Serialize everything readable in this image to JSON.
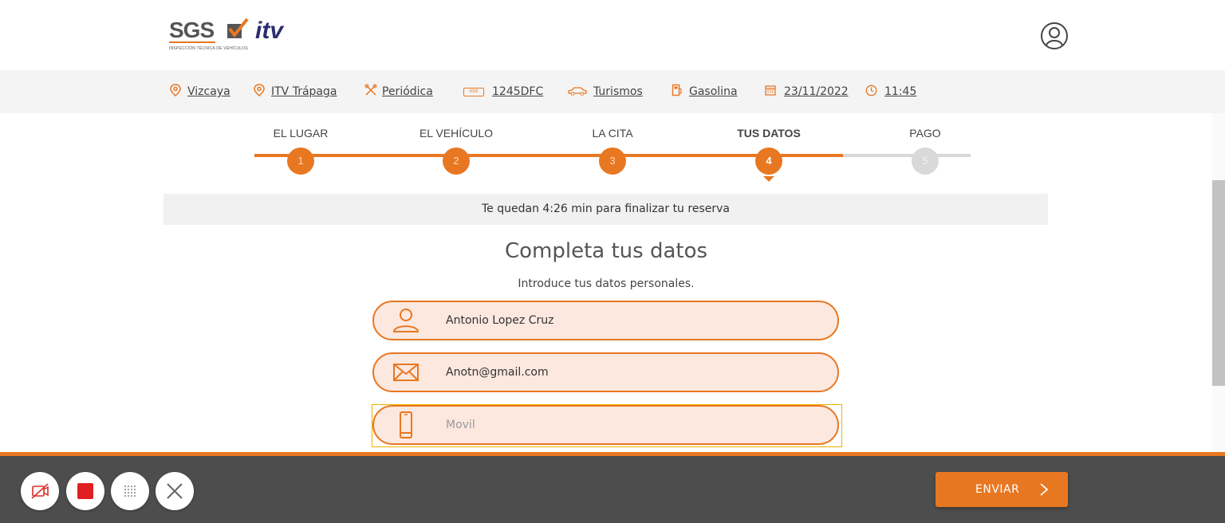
{
  "brand": {
    "logo_text": "SGS",
    "logo_brand": "itv",
    "logo_tagline": "INSPECCIÓN TÉCNICA DE VEHÍCULOS",
    "accent": "#e87722",
    "navy": "#2b2d6e"
  },
  "summary": {
    "province": "Vizcaya",
    "station": "ITV Trápaga",
    "inspection_type": "Periódica",
    "plate": "1245DFC",
    "vehicle_type": "Turismos",
    "fuel": "Gasolina",
    "date": "23/11/2022",
    "time": "11:45"
  },
  "steps": [
    {
      "label": "EL LUGAR",
      "number": "1",
      "state": "done"
    },
    {
      "label": "EL VEHÍCULO",
      "number": "2",
      "state": "done"
    },
    {
      "label": "LA CITA",
      "number": "3",
      "state": "done"
    },
    {
      "label": "TUS DATOS",
      "number": "4",
      "state": "current"
    },
    {
      "label": "PAGO",
      "number": "5",
      "state": "todo"
    }
  ],
  "timer_text": "Te quedan 4:26 min para finalizar tu reserva",
  "form": {
    "title": "Completa tus datos",
    "subtitle": "Introduce tus datos personales.",
    "name_value": "Antonio Lopez Cruz",
    "email_value": "Anotn@gmail.com",
    "phone_value": "",
    "phone_placeholder": "Movil"
  },
  "footer": {
    "submit_label": "ENVIAR",
    "controls": [
      "camera-off-icon",
      "stop-record-icon",
      "keypad-icon",
      "close-icon"
    ]
  }
}
